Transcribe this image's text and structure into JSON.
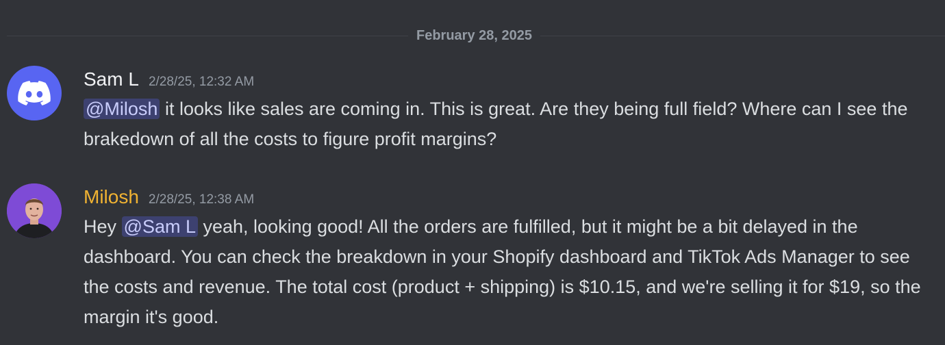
{
  "date_divider": "February 28, 2025",
  "messages": [
    {
      "username": "Sam L",
      "timestamp": "2/28/25, 12:32 AM",
      "avatar_icon": "discord-logo-icon",
      "mention": "@Milosh",
      "text": " it looks like sales are coming in. This is great. Are they being full field? Where can I see the brakedown of all the costs to figure profit margins?"
    },
    {
      "username": "Milosh",
      "timestamp": "2/28/25, 12:38 AM",
      "avatar_icon": "user-photo-avatar",
      "prefix": "Hey ",
      "mention": "@Sam L",
      "text": " yeah, looking good! All the orders are fulfilled, but it might be a bit delayed in the dashboard. You can check the breakdown in your Shopify dashboard and TikTok Ads Manager to see the costs and revenue. The total cost (product + shipping) is $10.15, and we're selling it for $19, so the margin it's good."
    }
  ],
  "colors": {
    "background": "#313338",
    "discord_blurple": "#5865f2",
    "milosh_name": "#f0b232",
    "mention_text": "#c9cdfb",
    "timestamp": "#949ba4"
  }
}
